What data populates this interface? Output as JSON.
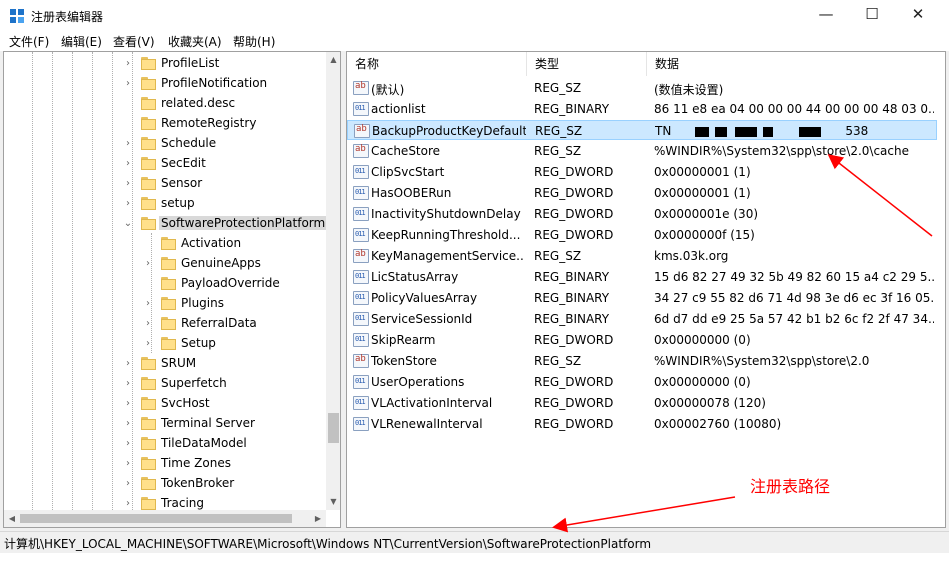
{
  "window": {
    "title": "注册表编辑器",
    "minimize": "—",
    "maximize": "☐",
    "close": "✕"
  },
  "menu": [
    "文件(F)",
    "编辑(E)",
    "查看(V)",
    "收藏夹(A)",
    "帮助(H)"
  ],
  "tree": [
    {
      "label": "ProfileList",
      "expander": "›"
    },
    {
      "label": "ProfileNotification",
      "expander": "›"
    },
    {
      "label": "related.desc",
      "expander": ""
    },
    {
      "label": "RemoteRegistry",
      "expander": ""
    },
    {
      "label": "Schedule",
      "expander": "›"
    },
    {
      "label": "SecEdit",
      "expander": "›"
    },
    {
      "label": "Sensor",
      "expander": "›"
    },
    {
      "label": "setup",
      "expander": "›"
    },
    {
      "label": "SoftwareProtectionPlatform",
      "expander": "⌄",
      "selected": true
    },
    {
      "label": "Activation",
      "expander": "",
      "child": true
    },
    {
      "label": "GenuineApps",
      "expander": "›",
      "child": true
    },
    {
      "label": "PayloadOverride",
      "expander": "",
      "child": true
    },
    {
      "label": "Plugins",
      "expander": "›",
      "child": true
    },
    {
      "label": "ReferralData",
      "expander": "›",
      "child": true
    },
    {
      "label": "Setup",
      "expander": "›",
      "child": true
    },
    {
      "label": "SRUM",
      "expander": "›"
    },
    {
      "label": "Superfetch",
      "expander": "›"
    },
    {
      "label": "SvcHost",
      "expander": "›"
    },
    {
      "label": "Terminal Server",
      "expander": "›"
    },
    {
      "label": "TileDataModel",
      "expander": "›"
    },
    {
      "label": "Time Zones",
      "expander": "›"
    },
    {
      "label": "TokenBroker",
      "expander": "›"
    },
    {
      "label": "Tracing",
      "expander": "›"
    }
  ],
  "columns": {
    "name": "名称",
    "type": "类型",
    "data": "数据"
  },
  "values": [
    {
      "name": "(默认)",
      "type": "REG_SZ",
      "data": "(数值未设置)",
      "icon": "sz"
    },
    {
      "name": "actionlist",
      "type": "REG_BINARY",
      "data": "86 11 e8 ea 04 00 00 00 44 00 00 00 48 03 0...",
      "icon": "bin"
    },
    {
      "name": "BackupProductKeyDefault",
      "type": "REG_SZ",
      "data_prefix": "TN",
      "data_suffix": "538",
      "icon": "sz",
      "selected": true,
      "redacted": true
    },
    {
      "name": "CacheStore",
      "type": "REG_SZ",
      "data": "%WINDIR%\\System32\\spp\\store\\2.0\\cache",
      "icon": "sz"
    },
    {
      "name": "ClipSvcStart",
      "type": "REG_DWORD",
      "data": "0x00000001 (1)",
      "icon": "bin"
    },
    {
      "name": "HasOOBERun",
      "type": "REG_DWORD",
      "data": "0x00000001 (1)",
      "icon": "bin"
    },
    {
      "name": "InactivityShutdownDelay",
      "type": "REG_DWORD",
      "data": "0x0000001e (30)",
      "icon": "bin"
    },
    {
      "name": "KeepRunningThreshold...",
      "type": "REG_DWORD",
      "data": "0x0000000f (15)",
      "icon": "bin"
    },
    {
      "name": "KeyManagementService...",
      "type": "REG_SZ",
      "data": "kms.03k.org",
      "icon": "sz"
    },
    {
      "name": "LicStatusArray",
      "type": "REG_BINARY",
      "data": "15 d6 82 27 49 32 5b 49 82 60 15 a4 c2 29 5...",
      "icon": "bin"
    },
    {
      "name": "PolicyValuesArray",
      "type": "REG_BINARY",
      "data": "34 27 c9 55 82 d6 71 4d 98 3e d6 ec 3f 16 05...",
      "icon": "bin"
    },
    {
      "name": "ServiceSessionId",
      "type": "REG_BINARY",
      "data": "6d d7 dd e9 25 5a 57 42 b1 b2 6c f2 2f 47 34...",
      "icon": "bin"
    },
    {
      "name": "SkipRearm",
      "type": "REG_DWORD",
      "data": "0x00000000 (0)",
      "icon": "bin"
    },
    {
      "name": "TokenStore",
      "type": "REG_SZ",
      "data": "%WINDIR%\\System32\\spp\\store\\2.0",
      "icon": "sz"
    },
    {
      "name": "UserOperations",
      "type": "REG_DWORD",
      "data": "0x00000000 (0)",
      "icon": "bin"
    },
    {
      "name": "VLActivationInterval",
      "type": "REG_DWORD",
      "data": "0x00000078 (120)",
      "icon": "bin"
    },
    {
      "name": "VLRenewalInterval",
      "type": "REG_DWORD",
      "data": "0x00002760 (10080)",
      "icon": "bin"
    }
  ],
  "status": {
    "path": "计算机\\HKEY_LOCAL_MACHINE\\SOFTWARE\\Microsoft\\Windows NT\\CurrentVersion\\SoftwareProtectionPlatform"
  },
  "annotation": {
    "label": "注册表路径",
    "color": "#ff0000"
  },
  "colors": {
    "selection": "#cce8ff",
    "selection_border": "#99d1ff",
    "annotation": "#ff0000"
  }
}
